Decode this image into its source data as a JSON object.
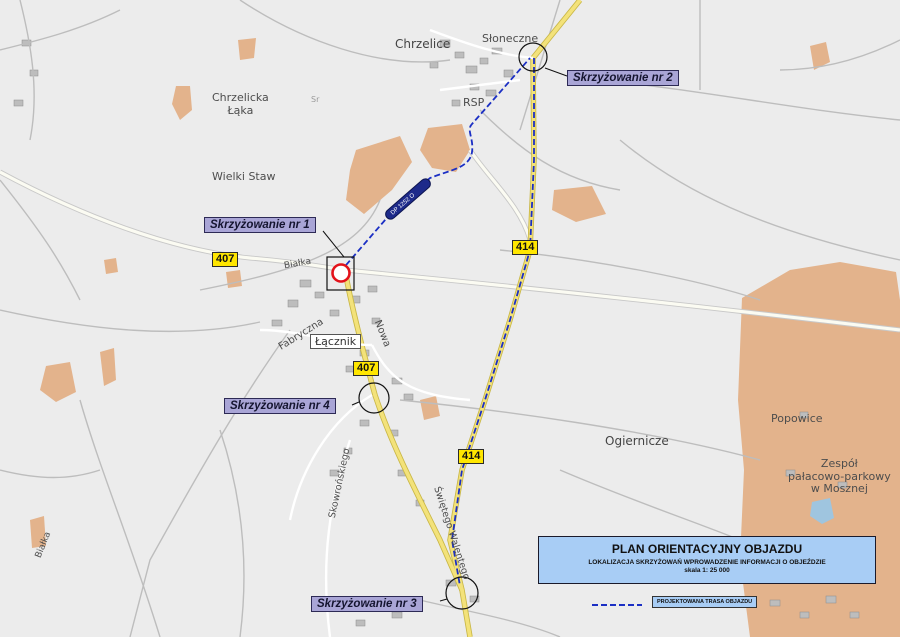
{
  "map": {
    "colors": {
      "background": "#ececec",
      "forest": "#e3b38c",
      "route": "#1b2fc4",
      "road_major": "#fbfbf2",
      "road_main": "#f3e27a",
      "panel": "#a8cdf5",
      "junction_label": "#a9a5d6"
    },
    "places": {
      "chrzelice": "Chrzelice",
      "sloneczne": "Słoneczne",
      "chrzelicka_laka": "Chrzelicka\nŁąka",
      "wielki_staw": "Wielki Staw",
      "rsp": "RSP",
      "lacznik": "Łącznik",
      "fabryczna": "Fabryczna",
      "nowa": "Nowa",
      "bialka_road": "Białka",
      "bialka_river": "Białka",
      "skowronskiego": "Skowrońskiego",
      "swietego_walentego": "Świętego Walentego",
      "ogiernicze": "Ogiernicze",
      "popowice": "Popowice",
      "zespol": "Zespół\npałacowo-parkowy\nw Mosznej",
      "sr_label": "Sr"
    },
    "road_shields": {
      "r407_west": "407",
      "r407_center": "407",
      "r414_north": "414",
      "r414_south": "414"
    },
    "junctions": {
      "j1": "Skrzyżowanie nr 1",
      "j2": "Skrzyżowanie nr 2",
      "j3": "Skrzyżowanie nr 3",
      "j4": "Skrzyżowanie nr 4"
    },
    "road_sign_text": "DP 1252 O",
    "title_panel": {
      "title": "PLAN ORIENTACYJNY OBJAZDU",
      "subtitle": "LOKALIZACJA SKRZYŻOWAŃ WPROWADZENIE INFORMACJI O OBJEŹDZIE",
      "scale": "skala 1: 25 000"
    },
    "legend": {
      "route_label": "PROJEKTOWANA TRASA OBJAZDU"
    }
  }
}
